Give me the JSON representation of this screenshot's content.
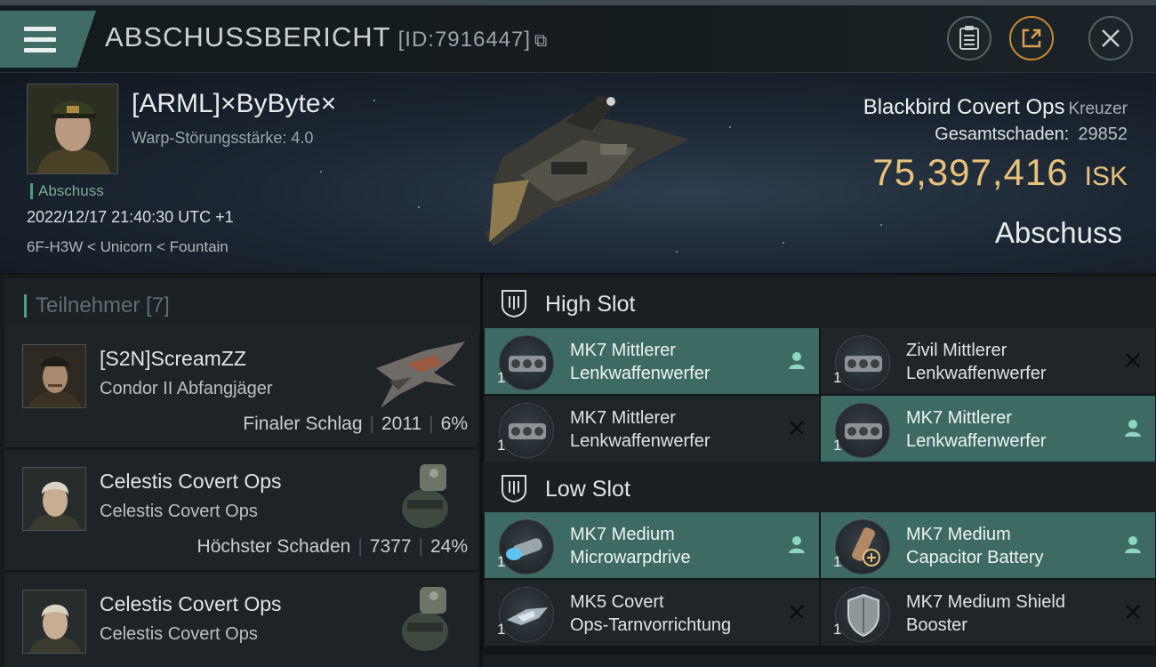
{
  "header": {
    "title": "ABSCHUSSBERICHT",
    "id": "[ID:7916447]",
    "copy_glyph": "⧉"
  },
  "victim": {
    "pilot": "[ARML]×ByByte×",
    "warp_strength": "Warp-Störungsstärke: 4.0",
    "tag": "Abschuss",
    "datetime": "2022/12/17 21:40:30 UTC +1",
    "location": "6F-H3W < Unicorn < Fountain",
    "ship": "Blackbird Covert Ops",
    "ship_class": "Kreuzer",
    "damage_label": "Gesamtschaden:",
    "damage_value": "29852",
    "isk_value": "75,397,416",
    "isk_unit": "ISK",
    "result": "Abschuss"
  },
  "participants": {
    "title": "Teilnehmer [7]",
    "items": [
      {
        "name": "[S2N]ScreamZZ",
        "ship": "Condor II Abfangjäger",
        "role": "Finaler Schlag",
        "damage": "2011",
        "percent": "6%"
      },
      {
        "name": "Celestis Covert Ops",
        "ship": "Celestis Covert Ops",
        "role": "Höchster Schaden",
        "damage": "7377",
        "percent": "24%"
      },
      {
        "name": "Celestis Covert Ops",
        "ship": "Celestis Covert Ops",
        "role": "",
        "damage": "",
        "percent": ""
      }
    ]
  },
  "fitting": {
    "high_slot": {
      "title": "High Slot",
      "modules": [
        {
          "line1": "MK7 Mittlerer",
          "line2": "Lenkwaffenwerfer",
          "qty": "1",
          "status": "person-icon",
          "active": true
        },
        {
          "line1": "Zivil Mittlerer",
          "line2": "Lenkwaffenwerfer",
          "qty": "1",
          "status": "x-icon",
          "active": false
        },
        {
          "line1": "MK7 Mittlerer",
          "line2": "Lenkwaffenwerfer",
          "qty": "1",
          "status": "x-icon",
          "active": false
        },
        {
          "line1": "MK7 Mittlerer",
          "line2": "Lenkwaffenwerfer",
          "qty": "1",
          "status": "person-icon",
          "active": true
        }
      ]
    },
    "low_slot": {
      "title": "Low Slot",
      "modules": [
        {
          "line1": "MK7 Medium",
          "line2": "Microwarpdrive",
          "qty": "1",
          "status": "person-icon",
          "active": true
        },
        {
          "line1": "MK7 Medium",
          "line2": "Capacitor Battery",
          "qty": "1",
          "status": "person-icon",
          "active": true
        },
        {
          "line1": "MK5 Covert",
          "line2": "Ops-Tarnvorrichtung",
          "qty": "1",
          "status": "x-icon",
          "active": false
        },
        {
          "line1": "MK7 Medium Shield",
          "line2": "Booster",
          "qty": "1",
          "status": "x-icon",
          "active": false
        }
      ]
    }
  },
  "colors": {
    "accent_teal": "#3d6b64",
    "isk_gold": "#e7c27a",
    "tag_green": "#4f9a82"
  }
}
